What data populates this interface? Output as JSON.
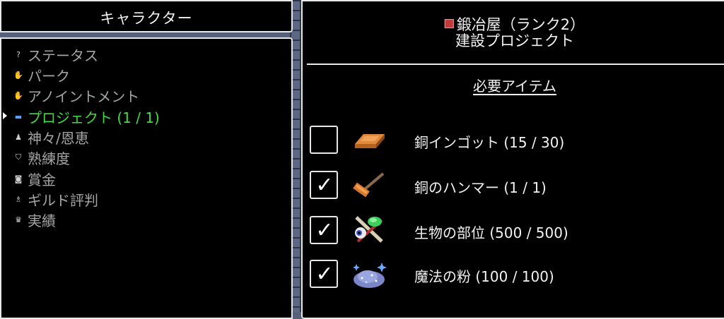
{
  "left_panel": {
    "title": "キャラクター",
    "menu": [
      {
        "icon": "question-icon",
        "glyph": "?",
        "label": "ステータス",
        "active": false
      },
      {
        "icon": "hand-icon",
        "glyph": "✋",
        "label": "パーク",
        "active": false
      },
      {
        "icon": "hand-icon",
        "glyph": "✋",
        "label": "アノイントメント",
        "active": false
      },
      {
        "icon": "scroll-icon",
        "glyph": "▬",
        "label": "プロジェクト (1 / 1)",
        "active": true
      },
      {
        "icon": "statue-icon",
        "glyph": "♟",
        "label": "神々/恩恵",
        "active": false
      },
      {
        "icon": "shield-icon",
        "glyph": "⛉",
        "label": "熟練度",
        "active": false
      },
      {
        "icon": "coin-icon",
        "glyph": "◙",
        "label": "賞金",
        "active": false
      },
      {
        "icon": "ribbon-icon",
        "glyph": "♗",
        "label": "ギルド評判",
        "active": false
      },
      {
        "icon": "trophy-icon",
        "glyph": "♛",
        "label": "実績",
        "active": false
      }
    ]
  },
  "right_panel": {
    "header_line1": "鍛冶屋（ランク2）",
    "header_line2": "建設プロジェクト",
    "required_title": "必要アイテム",
    "items": [
      {
        "label": "銅インゴット (15 / 30)",
        "checked": false,
        "icon": "copper-ingot-icon"
      },
      {
        "label": "銅のハンマー (1 / 1)",
        "checked": true,
        "icon": "copper-hammer-icon"
      },
      {
        "label": "生物の部位 (500 / 500)",
        "checked": true,
        "icon": "creature-parts-icon"
      },
      {
        "label": "魔法の粉 (100 / 100)",
        "checked": true,
        "icon": "magic-dust-icon"
      }
    ]
  },
  "colors": {
    "active": "#3fdc3f",
    "inactive": "#a5a5a5",
    "panel_bg": "#000000",
    "border": "#e8e8e8",
    "wall": "#5c6781"
  }
}
